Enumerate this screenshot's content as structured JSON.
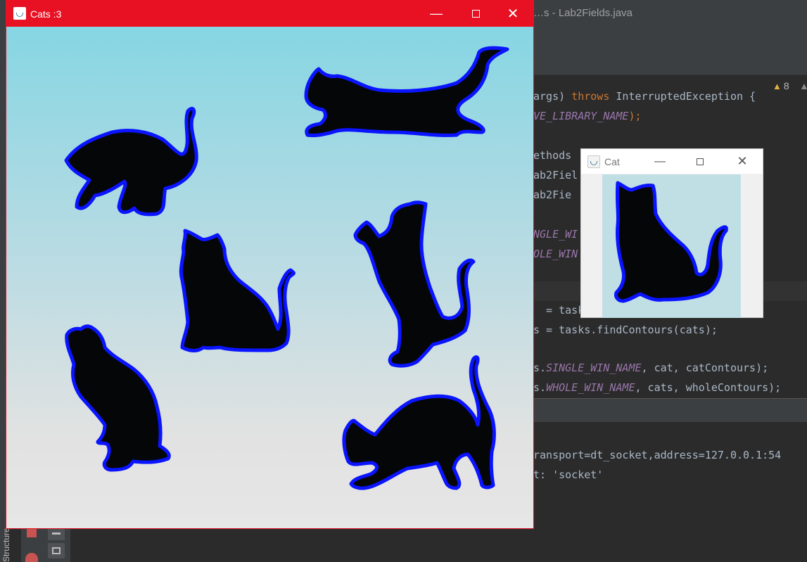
{
  "ide": {
    "title": "…s - Lab2Fields.java",
    "warning_count": "8",
    "code_lines": [
      {
        "parts": [
          {
            "t": "args) ",
            "c": ""
          },
          {
            "t": "throws",
            "c": "kw"
          },
          {
            "t": " InterruptedException {",
            "c": ""
          }
        ]
      },
      {
        "parts": [
          {
            "t": "VE_LIBRARY_NAME",
            "c": "fld"
          },
          {
            "t": ");",
            "c": "kw"
          }
        ]
      },
      {
        "parts": [
          {
            "t": "",
            "c": ""
          }
        ]
      },
      {
        "parts": [
          {
            "t": "ethods",
            "c": ""
          }
        ]
      },
      {
        "parts": [
          {
            "t": "ab2Fiel",
            "c": ""
          }
        ]
      },
      {
        "parts": [
          {
            "t": "ab2Fie",
            "c": ""
          }
        ]
      },
      {
        "parts": [
          {
            "t": "",
            "c": ""
          }
        ]
      },
      {
        "parts": [
          {
            "t": "NGLE_WI",
            "c": "fld"
          }
        ]
      },
      {
        "parts": [
          {
            "t": "OLE_WIN",
            "c": "fld"
          }
        ]
      },
      {
        "parts": [
          {
            "t": "",
            "c": ""
          }
        ]
      },
      {
        "parts": [
          {
            "t": "  = tasks",
            "c": ""
          }
        ]
      },
      {
        "parts": [
          {
            "t": "s = tasks.findContours(cats);",
            "c": ""
          }
        ]
      },
      {
        "parts": [
          {
            "t": "",
            "c": ""
          }
        ]
      },
      {
        "parts": [
          {
            "t": "s.",
            "c": ""
          },
          {
            "t": "SINGLE_WIN_NAME",
            "c": "fld"
          },
          {
            "t": ", cat, catContours);",
            "c": ""
          }
        ]
      },
      {
        "parts": [
          {
            "t": "s.",
            "c": ""
          },
          {
            "t": "WHOLE_WIN_NAME",
            "c": "fld"
          },
          {
            "t": ", cats, wholeContours);",
            "c": ""
          }
        ]
      }
    ],
    "console_lines": [
      "ransport=dt_socket,address=127.0.0.1:54",
      "t: 'socket'"
    ],
    "structure_tab": "Structure"
  },
  "cats_window": {
    "title": "Cats :3",
    "minimize_glyph": "—",
    "close_glyph": "✕",
    "cat_count": 6
  },
  "cat_window": {
    "title": "Cat",
    "minimize_glyph": "—",
    "close_glyph": "✕"
  },
  "colors": {
    "active_titlebar": "#e81123",
    "contour": "#0a14ff",
    "silhouette": "#050607",
    "gradient_top": "#86d6e3",
    "gradient_bottom": "#e6e6e6"
  }
}
